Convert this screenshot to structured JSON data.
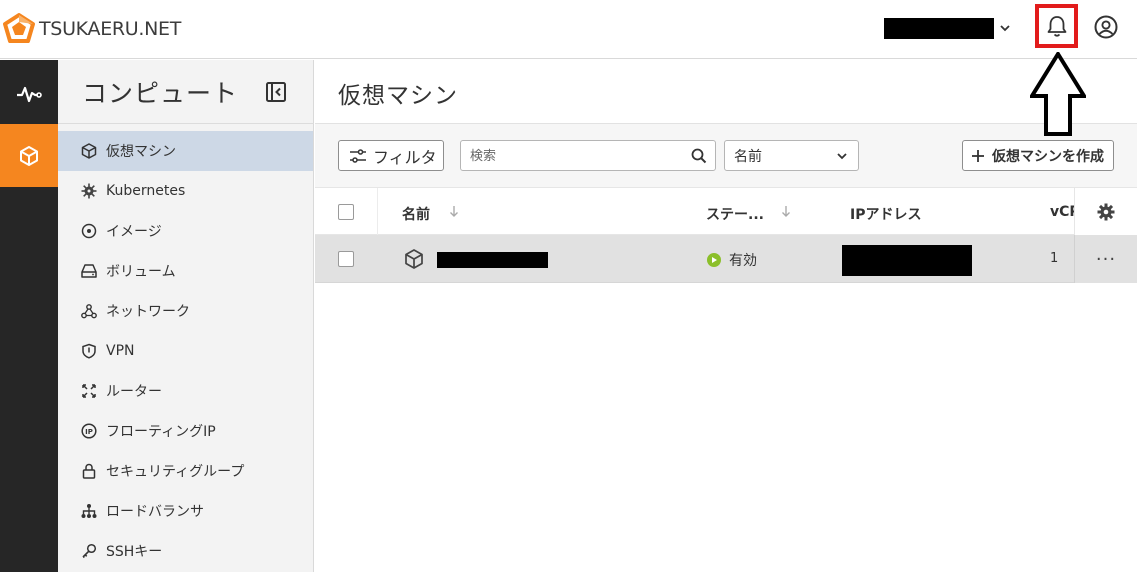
{
  "brand": {
    "name": "TSUKAERU.NET"
  },
  "header": {
    "user_menu_value": "",
    "icons": [
      "bell-icon",
      "user-circle-icon"
    ],
    "highlight_color": "#e21b1b"
  },
  "rail": {
    "items": [
      {
        "icon": "activity-icon"
      },
      {
        "icon": "cube-icon",
        "active": true
      }
    ],
    "active_color": "#f5861f"
  },
  "sidebar": {
    "title": "コンピュート",
    "items": [
      {
        "label": "仮想マシン",
        "icon": "cube-icon",
        "active": true
      },
      {
        "label": "Kubernetes",
        "icon": "helm-wheel-icon"
      },
      {
        "label": "イメージ",
        "icon": "disc-icon"
      },
      {
        "label": "ボリューム",
        "icon": "drive-icon"
      },
      {
        "label": "ネットワーク",
        "icon": "network-icon"
      },
      {
        "label": "VPN",
        "icon": "shield-icon"
      },
      {
        "label": "ルーター",
        "icon": "router-arrows-icon"
      },
      {
        "label": "フローティングIP",
        "icon": "ip-circle-icon"
      },
      {
        "label": "セキュリティグループ",
        "icon": "lock-icon"
      },
      {
        "label": "ロードバランサ",
        "icon": "hierarchy-icon"
      },
      {
        "label": "SSHキー",
        "icon": "key-icon"
      }
    ]
  },
  "main": {
    "title": "仮想マシン",
    "toolbar": {
      "filter_label": "フィルタ",
      "search_placeholder": "検索",
      "sort_selected": "名前",
      "create_label": "仮想マシンを作成"
    },
    "table": {
      "columns": [
        "名前",
        "ステー...",
        "IPアドレス",
        "vCP"
      ],
      "rows": [
        {
          "name": "",
          "status": "有効",
          "ip": "",
          "vcpu": "1",
          "actions": "···"
        }
      ]
    }
  }
}
